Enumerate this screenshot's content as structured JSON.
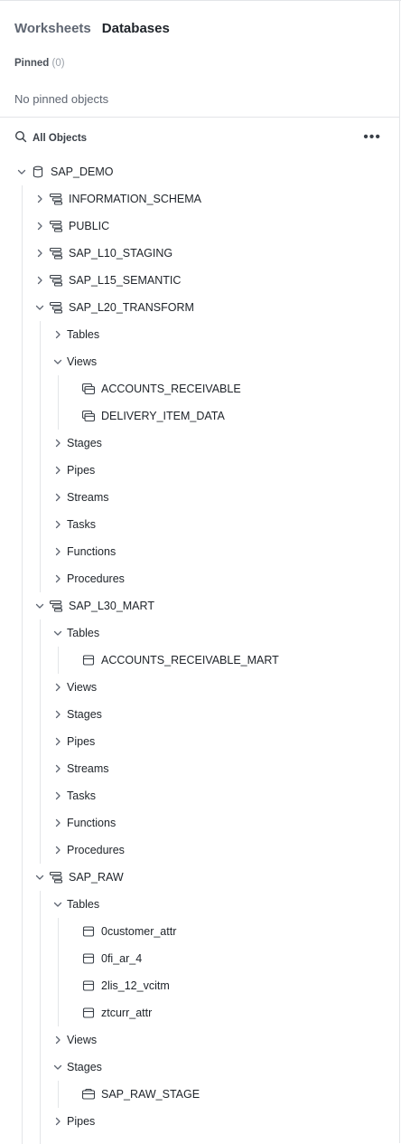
{
  "tabs": {
    "worksheets": "Worksheets",
    "databases": "Databases"
  },
  "pinned": {
    "label": "Pinned",
    "count": "(0)",
    "empty": "No pinned objects"
  },
  "search": {
    "label": "All Objects",
    "more_icon": "ellipsis-icon"
  },
  "tree": [
    {
      "label": "SAP_DEMO",
      "level": 0,
      "type": "database",
      "expanded": true
    },
    {
      "label": "INFORMATION_SCHEMA",
      "level": 1,
      "type": "schema",
      "expanded": false
    },
    {
      "label": "PUBLIC",
      "level": 1,
      "type": "schema",
      "expanded": false
    },
    {
      "label": "SAP_L10_STAGING",
      "level": 1,
      "type": "schema",
      "expanded": false
    },
    {
      "label": "SAP_L15_SEMANTIC",
      "level": 1,
      "type": "schema",
      "expanded": false
    },
    {
      "label": "SAP_L20_TRANSFORM",
      "level": 1,
      "type": "schema",
      "expanded": true
    },
    {
      "label": "Tables",
      "level": 2,
      "type": "folder",
      "expanded": false
    },
    {
      "label": "Views",
      "level": 2,
      "type": "folder",
      "expanded": true
    },
    {
      "label": "ACCOUNTS_RECEIVABLE",
      "level": 3,
      "type": "view"
    },
    {
      "label": "DELIVERY_ITEM_DATA",
      "level": 3,
      "type": "view"
    },
    {
      "label": "Stages",
      "level": 2,
      "type": "folder",
      "expanded": false
    },
    {
      "label": "Pipes",
      "level": 2,
      "type": "folder",
      "expanded": false
    },
    {
      "label": "Streams",
      "level": 2,
      "type": "folder",
      "expanded": false
    },
    {
      "label": "Tasks",
      "level": 2,
      "type": "folder",
      "expanded": false
    },
    {
      "label": "Functions",
      "level": 2,
      "type": "folder",
      "expanded": false
    },
    {
      "label": "Procedures",
      "level": 2,
      "type": "folder",
      "expanded": false
    },
    {
      "label": "SAP_L30_MART",
      "level": 1,
      "type": "schema",
      "expanded": true
    },
    {
      "label": "Tables",
      "level": 2,
      "type": "folder",
      "expanded": true
    },
    {
      "label": "ACCOUNTS_RECEIVABLE_MART",
      "level": 3,
      "type": "table"
    },
    {
      "label": "Views",
      "level": 2,
      "type": "folder",
      "expanded": false
    },
    {
      "label": "Stages",
      "level": 2,
      "type": "folder",
      "expanded": false
    },
    {
      "label": "Pipes",
      "level": 2,
      "type": "folder",
      "expanded": false
    },
    {
      "label": "Streams",
      "level": 2,
      "type": "folder",
      "expanded": false
    },
    {
      "label": "Tasks",
      "level": 2,
      "type": "folder",
      "expanded": false
    },
    {
      "label": "Functions",
      "level": 2,
      "type": "folder",
      "expanded": false
    },
    {
      "label": "Procedures",
      "level": 2,
      "type": "folder",
      "expanded": false
    },
    {
      "label": "SAP_RAW",
      "level": 1,
      "type": "schema",
      "expanded": true
    },
    {
      "label": "Tables",
      "level": 2,
      "type": "folder",
      "expanded": true
    },
    {
      "label": "0customer_attr",
      "level": 3,
      "type": "table"
    },
    {
      "label": "0fi_ar_4",
      "level": 3,
      "type": "table"
    },
    {
      "label": "2lis_12_vcitm",
      "level": 3,
      "type": "table"
    },
    {
      "label": "ztcurr_attr",
      "level": 3,
      "type": "table"
    },
    {
      "label": "Views",
      "level": 2,
      "type": "folder",
      "expanded": false
    },
    {
      "label": "Stages",
      "level": 2,
      "type": "folder",
      "expanded": true
    },
    {
      "label": "SAP_RAW_STAGE",
      "level": 3,
      "type": "stage"
    },
    {
      "label": "Pipes",
      "level": 2,
      "type": "folder",
      "expanded": false
    }
  ]
}
